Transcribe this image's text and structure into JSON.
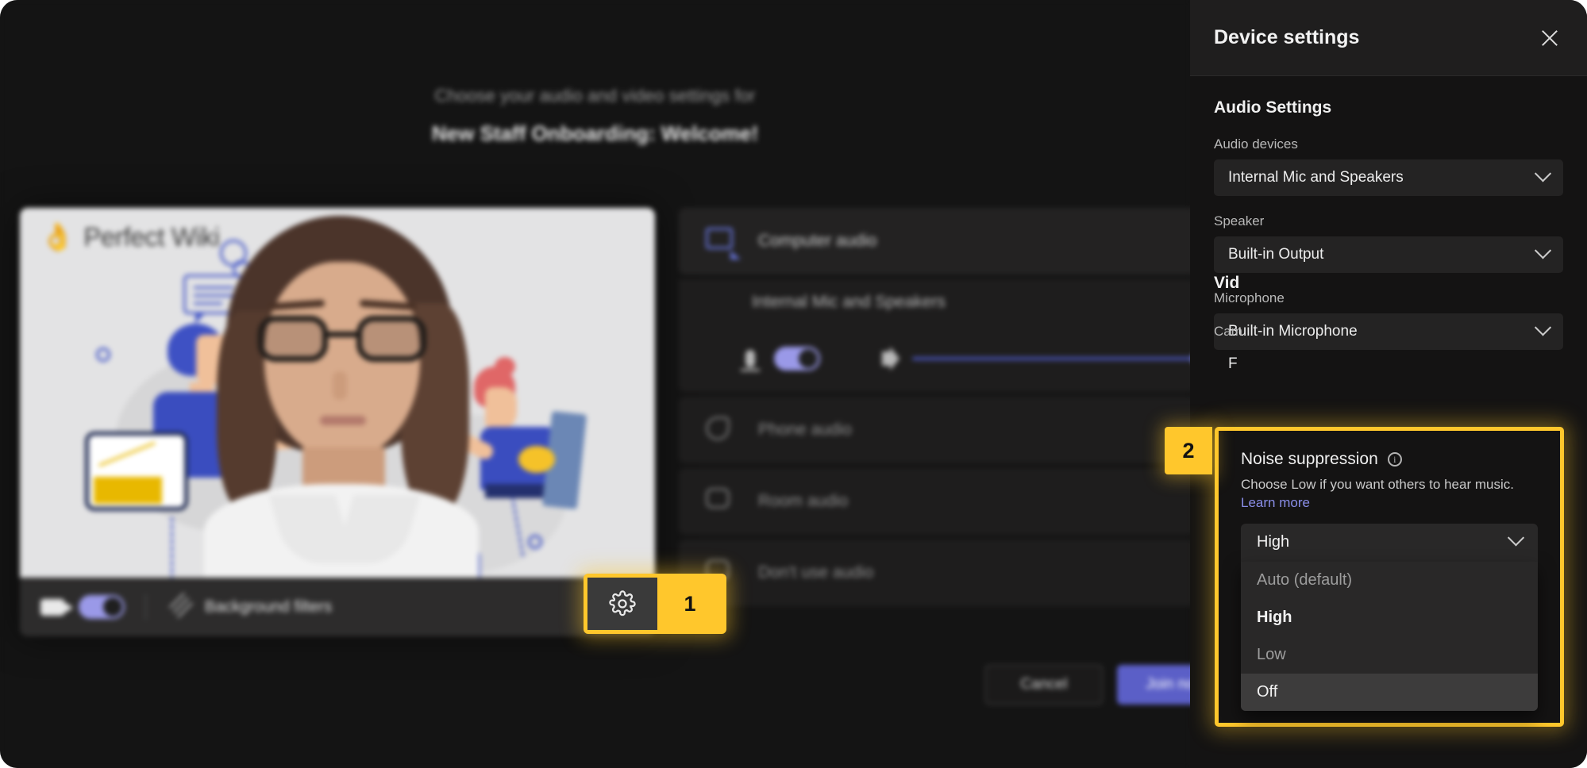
{
  "prejoin": {
    "subtitle": "Choose your audio and video settings for",
    "title": "New Staff Onboarding: Welcome!",
    "brand": {
      "emoji": "👌",
      "name": "Perfect Wiki"
    },
    "video_toolbar": {
      "camera_icon": "camera-icon",
      "camera_toggle_state": "on",
      "background_filters_label": "Background filters",
      "background_filters_icon": "background-filters-icon"
    },
    "audio_options": [
      {
        "icon": "computer-monitor-icon",
        "label": "Computer audio",
        "selected": true
      },
      {
        "icon": "phone-icon",
        "label": "Phone audio",
        "selected": false
      },
      {
        "icon": "room-icon",
        "label": "Room audio",
        "selected": false
      },
      {
        "icon": "no-audio-icon",
        "label": "Don't use audio",
        "selected": false
      }
    ],
    "device_name": "Internal Mic and Speakers",
    "mic_toggle_state": "on",
    "mic_icon": "microphone-icon",
    "speaker_icon": "speaker-icon",
    "volume_percent": 100,
    "buttons": {
      "cancel": "Cancel",
      "join": "Join now"
    }
  },
  "device_panel": {
    "title": "Device settings",
    "close_icon": "close-icon",
    "audio_section_title": "Audio Settings",
    "fields": [
      {
        "label": "Audio devices",
        "value": "Internal Mic and Speakers"
      },
      {
        "label": "Speaker",
        "value": "Built-in Output"
      },
      {
        "label": "Microphone",
        "value": "Built-in Microphone"
      }
    ],
    "behind_labels": {
      "video_settings": "Vid",
      "camera": "Cam",
      "filters": "F"
    }
  },
  "noise_suppression": {
    "title": "Noise suppression",
    "info_icon": "info-icon",
    "description_prefix": "Choose Low if you want others to hear music. ",
    "learn_more": "Learn more",
    "selected_value": "High",
    "options": [
      {
        "label": "Auto (default)",
        "state": "normal"
      },
      {
        "label": "High",
        "state": "selected"
      },
      {
        "label": "Low",
        "state": "normal"
      },
      {
        "label": "Off",
        "state": "highlighted"
      }
    ]
  },
  "callouts": [
    {
      "id": "1",
      "target": "device-settings-gear-button"
    },
    {
      "id": "2",
      "target": "noise-suppression-dropdown"
    }
  ],
  "colors": {
    "accent_yellow": "#ffc72c",
    "teams_purple": "#5b5fc7",
    "panel_bg": "#141313",
    "window_bg": "#141414"
  }
}
